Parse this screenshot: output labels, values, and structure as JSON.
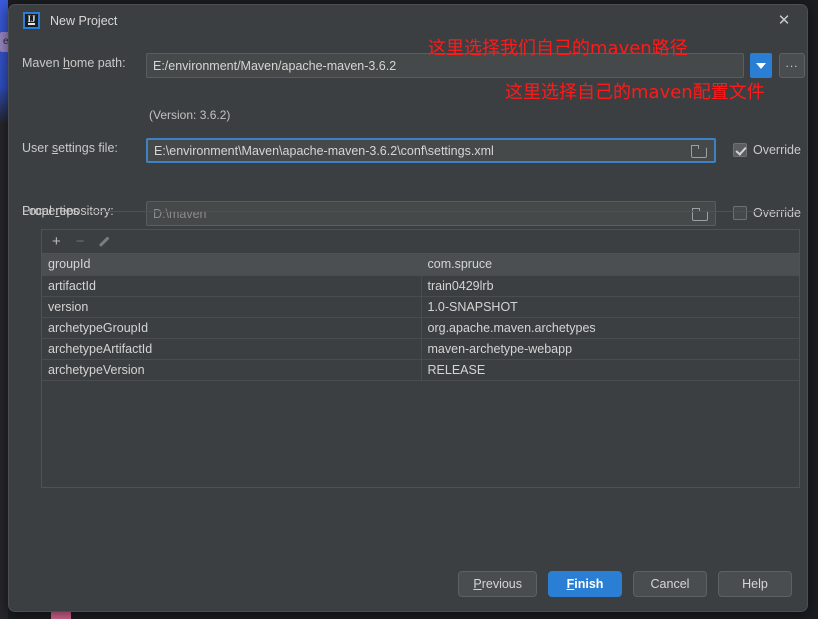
{
  "window": {
    "title": "New Project",
    "logo_text": "IJ",
    "close_icon": "close-icon"
  },
  "form": {
    "maven_home": {
      "label": "Maven home path:",
      "value": "E:/environment/Maven/apache-maven-3.6.2",
      "version_note": "(Version: 3.6.2)",
      "dropdown_icon": "chevron-down-icon",
      "ellipsis_label": "..."
    },
    "user_settings": {
      "label": "User settings file:",
      "value": "E:\\environment\\Maven\\apache-maven-3.6.2\\conf\\settings.xml",
      "browse_icon": "folder-icon",
      "override_label": "Override",
      "override_checked": true
    },
    "local_repository": {
      "label": "Local repository:",
      "placeholder": "D:\\maven",
      "browse_icon": "folder-icon",
      "override_label": "Override",
      "override_checked": false
    }
  },
  "properties": {
    "caption": "Properties",
    "toolbar": {
      "add_label": "+",
      "remove_label": "−",
      "edit_icon": "pencil-icon"
    },
    "rows": [
      {
        "key": "groupId",
        "value": "com.spruce"
      },
      {
        "key": "artifactId",
        "value": "train0429lrb"
      },
      {
        "key": "version",
        "value": "1.0-SNAPSHOT"
      },
      {
        "key": "archetypeGroupId",
        "value": "org.apache.maven.archetypes"
      },
      {
        "key": "archetypeArtifactId",
        "value": "maven-archetype-webapp"
      },
      {
        "key": "archetypeVersion",
        "value": "RELEASE"
      }
    ]
  },
  "footer": {
    "previous": "Previous",
    "finish": "Finish",
    "cancel": "Cancel",
    "help": "Help"
  },
  "annotations": [
    {
      "text": "这里选择我们自己的maven路径",
      "color": "#ff1a1a"
    },
    {
      "text": "这里选择自己的maven配置文件",
      "color": "#ff1a1a"
    }
  ],
  "background": {
    "badge_purple_text": "et"
  },
  "colors": {
    "accent_blue": "#2a7fd4",
    "dialog_bg": "#3c3f41",
    "field_bg": "#45494a",
    "annotation_red": "#ff1a1a"
  }
}
